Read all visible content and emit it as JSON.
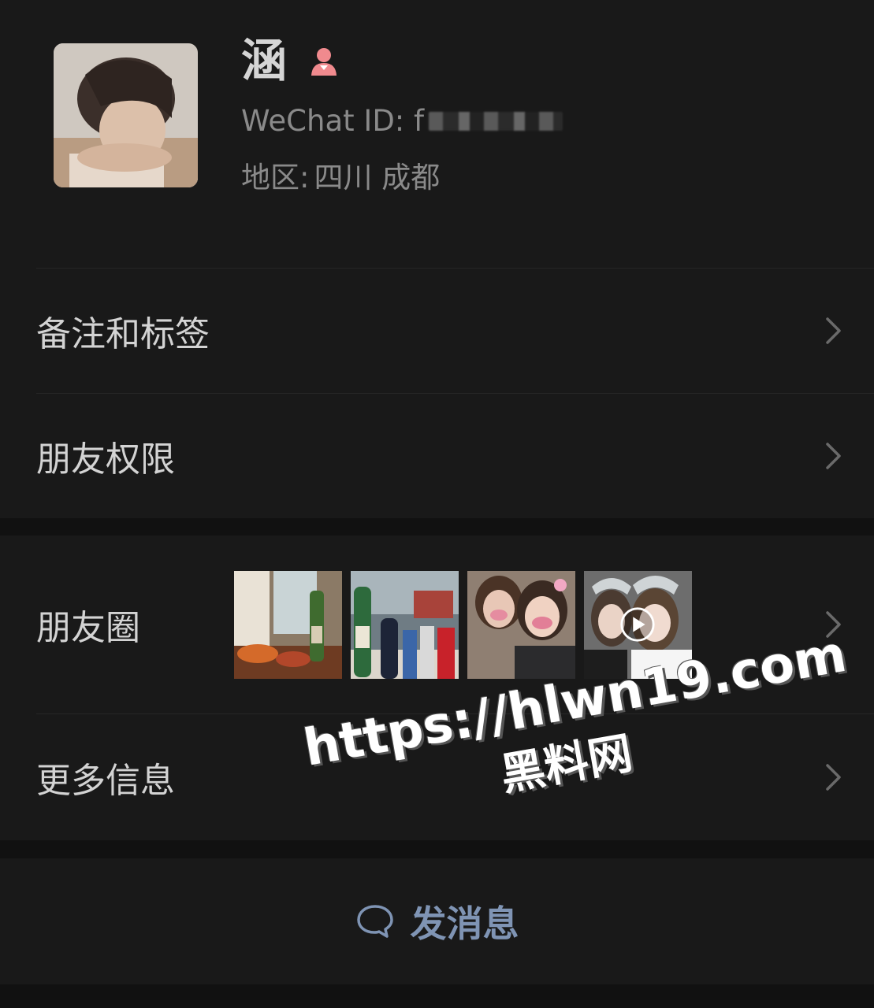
{
  "profile": {
    "name": "涵",
    "gender_icon": "female-icon",
    "wechat_id_label": "WeChat ID: f",
    "region_label": "地区:",
    "region_value": "四川 成都"
  },
  "menu": {
    "remarks_tags": "备注和标签",
    "friend_permissions": "朋友权限",
    "moments": "朋友圈",
    "more_info": "更多信息"
  },
  "moments_thumbnails": [
    {
      "icon": "photo-food-drinks"
    },
    {
      "icon": "photo-bottles-cans"
    },
    {
      "icon": "photo-selfie-filter"
    },
    {
      "icon": "video-selfie-filter"
    }
  ],
  "actions": {
    "send_message": "发消息"
  },
  "watermark": {
    "url": "https://hlwn19.com",
    "site": "黑料网"
  },
  "colors": {
    "background": "#111111",
    "card": "#191919",
    "text_primary": "#d3d3d3",
    "text_secondary": "#8a8a8a",
    "accent_link": "#7f94b4",
    "female_icon": "#f08a8e"
  }
}
